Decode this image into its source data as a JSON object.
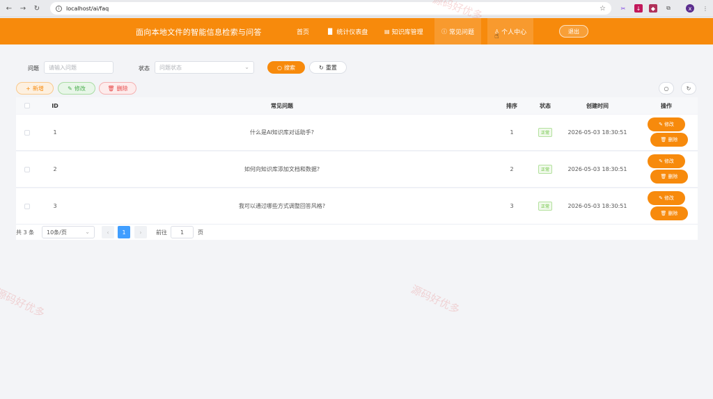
{
  "browser": {
    "url": "localhost/ai/faq"
  },
  "header": {
    "title": "面向本地文件的智能信息检索与问答",
    "nav": [
      "首页",
      "统计仪表盘",
      "知识库管理",
      "常见问题",
      "个人中心"
    ],
    "logout": "退出"
  },
  "search": {
    "question_label": "问题",
    "question_placeholder": "请输入问题",
    "status_label": "状态",
    "status_placeholder": "问题状态",
    "search_btn": "搜索",
    "reset_btn": "重置"
  },
  "toolbar": {
    "add": "新增",
    "edit": "修改",
    "delete": "删除"
  },
  "table": {
    "columns": [
      "ID",
      "常见问题",
      "排序",
      "状态",
      "创建时间",
      "操作"
    ],
    "rows": [
      {
        "id": "1",
        "question": "什么是AI知识库对话助手?",
        "sort": "1",
        "status": "正常",
        "created": "2026-05-03 18:30:51",
        "edit": "修改",
        "delete": "删除"
      },
      {
        "id": "2",
        "question": "如何向知识库添加文档和数据?",
        "sort": "2",
        "status": "正常",
        "created": "2026-05-03 18:30:51",
        "edit": "修改",
        "delete": "删除"
      },
      {
        "id": "3",
        "question": "我可以通过哪些方式调整回答风格?",
        "sort": "3",
        "status": "正常",
        "created": "2026-05-03 18:30:51",
        "edit": "修改",
        "delete": "删除"
      }
    ]
  },
  "pagination": {
    "total": "共 3 条",
    "page_size": "10条/页",
    "current_page": "1",
    "goto_label": "前往",
    "goto_value": "1",
    "page_suffix": "页"
  },
  "watermark": {
    "text": "源码好优多"
  },
  "colors": {
    "brand": "#f78a0c",
    "pager_active": "#409eff",
    "status_ok": "#67c23a"
  }
}
